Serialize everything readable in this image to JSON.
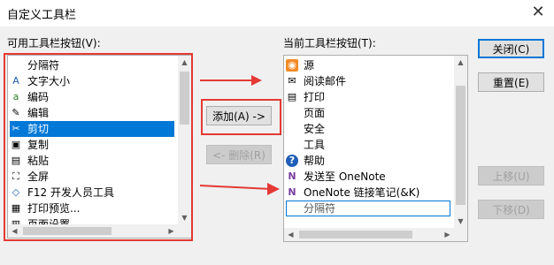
{
  "window": {
    "title": "自定义工具栏",
    "close_glyph": "✕"
  },
  "available": {
    "label": "可用工具栏按钮(V):",
    "items": [
      {
        "label": "分隔符",
        "icon": "none"
      },
      {
        "label": "文字大小",
        "icon": "text-size-icon",
        "glyph": "A"
      },
      {
        "label": "编码",
        "icon": "encoding-icon",
        "glyph": "a"
      },
      {
        "label": "编辑",
        "icon": "edit-pencil-icon",
        "glyph": "✎"
      },
      {
        "label": "剪切",
        "icon": "cut-icon",
        "glyph": "✂"
      },
      {
        "label": "复制",
        "icon": "copy-icon",
        "glyph": "▣"
      },
      {
        "label": "粘贴",
        "icon": "paste-icon",
        "glyph": "▤"
      },
      {
        "label": "全屏",
        "icon": "fullscreen-icon",
        "glyph": "⛶"
      },
      {
        "label": "F12 开发人员工具",
        "icon": "dev-tools-icon",
        "glyph": "◇"
      },
      {
        "label": "打印预览...",
        "icon": "print-preview-icon",
        "glyph": "▦"
      },
      {
        "label": "页面设置...",
        "icon": "page-setup-icon",
        "glyph": "▥"
      }
    ],
    "selected_index": 4
  },
  "current": {
    "label": "当前工具栏按钮(T):",
    "items": [
      {
        "label": "源",
        "icon": "rss-feed-icon",
        "glyph": "◉"
      },
      {
        "label": "阅读邮件",
        "icon": "read-mail-icon",
        "glyph": "✉"
      },
      {
        "label": "打印",
        "icon": "print-icon",
        "glyph": "▤"
      },
      {
        "label": "页面",
        "icon": "none"
      },
      {
        "label": "安全",
        "icon": "none"
      },
      {
        "label": "工具",
        "icon": "none"
      },
      {
        "label": "帮助",
        "icon": "help-icon",
        "glyph": "?"
      },
      {
        "label": "发送至 OneNote",
        "icon": "onenote-send-icon",
        "glyph": "N"
      },
      {
        "label": "OneNote 链接笔记(&K)",
        "icon": "onenote-link-icon",
        "glyph": "N"
      },
      {
        "label": "分隔符",
        "icon": "none"
      }
    ],
    "focused_index": 9
  },
  "buttons": {
    "add": "添加(A) ->",
    "remove": "<- 删除(R)",
    "close": "关闭(C)",
    "reset": "重置(E)",
    "move_up": "上移(U)",
    "move_down": "下移(D)"
  },
  "colors": {
    "selection": "#0078d7",
    "highlight_red": "#e53935",
    "rss": "#f28c28",
    "onenote": "#7b3fa0",
    "help": "#1e5eb8"
  }
}
